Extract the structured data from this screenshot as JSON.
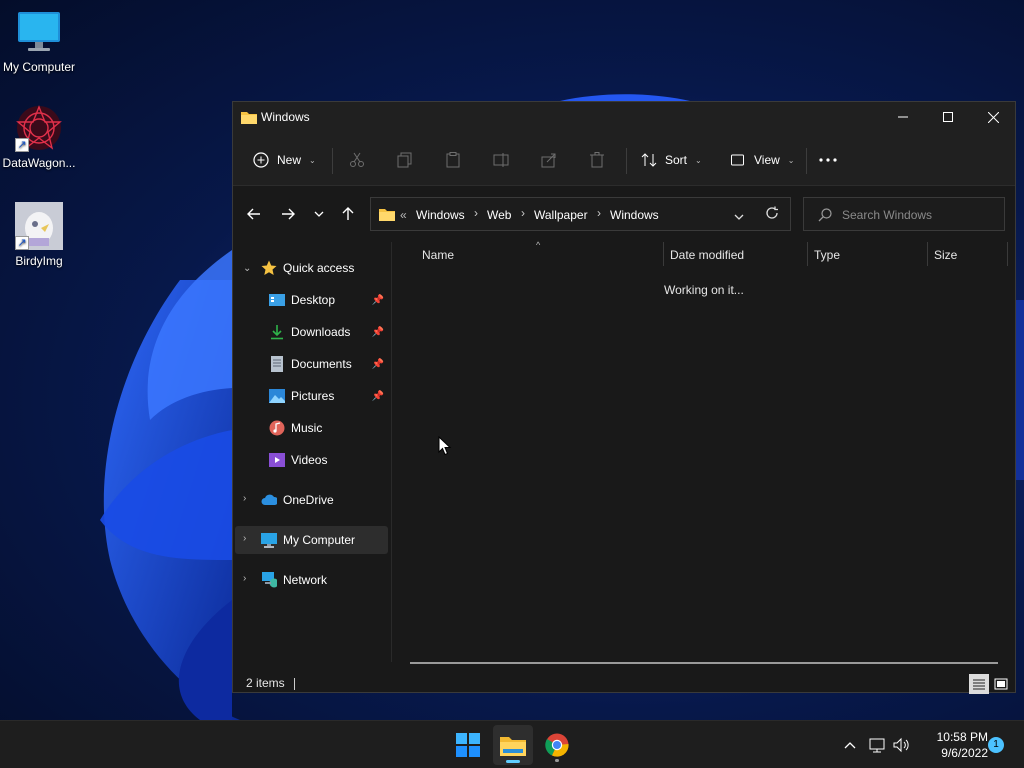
{
  "desktop": {
    "icons": [
      {
        "label": "My Computer",
        "icon": "monitor-icon"
      },
      {
        "label": "DataWagon...",
        "icon": "datawagon-icon"
      },
      {
        "label": "BirdyImg",
        "icon": "birdyimg-icon"
      }
    ]
  },
  "window": {
    "title": "Windows",
    "commands": {
      "new": "New",
      "sort": "Sort",
      "view": "View"
    },
    "breadcrumb": {
      "overflow": "«",
      "items": [
        "Windows",
        "Web",
        "Wallpaper",
        "Windows"
      ]
    },
    "search": {
      "placeholder": "Search Windows"
    },
    "sidebar": {
      "quick_access": "Quick access",
      "items": [
        {
          "label": "Desktop",
          "pinned": true
        },
        {
          "label": "Downloads",
          "pinned": true
        },
        {
          "label": "Documents",
          "pinned": true
        },
        {
          "label": "Pictures",
          "pinned": true
        },
        {
          "label": "Music",
          "pinned": false
        },
        {
          "label": "Videos",
          "pinned": false
        }
      ],
      "onedrive": "OneDrive",
      "my_computer": "My Computer",
      "network": "Network",
      "selected": "My Computer"
    },
    "columns": {
      "name": "Name",
      "date_modified": "Date modified",
      "type": "Type",
      "size": "Size"
    },
    "loading_text": "Working on it...",
    "status": {
      "item_count": "2 items"
    }
  },
  "taskbar": {
    "apps": [
      "start-icon",
      "file-explorer-icon",
      "chrome-icon"
    ],
    "clock": {
      "time": "10:58 PM",
      "date": "9/6/2022"
    },
    "notification_count": "1"
  },
  "colors": {
    "accent": "#60cdff",
    "window_bg": "#191919",
    "titlebar_bg": "#202020",
    "selected_bg": "#2d2d2d",
    "wallpaper_blue": "#1640d8"
  }
}
